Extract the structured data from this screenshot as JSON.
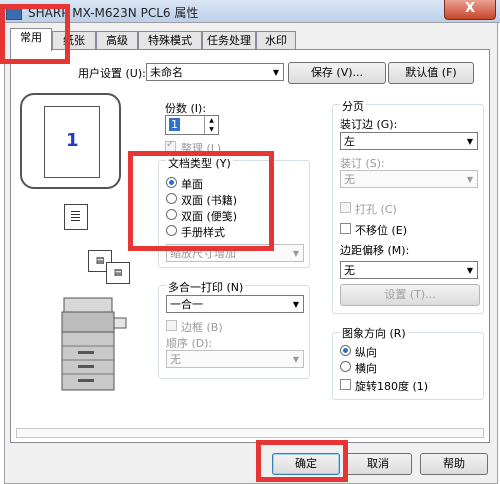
{
  "window": {
    "title": "SHARP MX-M623N PCL6 属性",
    "close_symbol": "X"
  },
  "tabs": [
    "常用",
    "纸张",
    "高级",
    "特殊模式",
    "任务处理",
    "水印"
  ],
  "user_settings": {
    "label": "用户设置 (U):",
    "value": "未命名",
    "save": "保存 (V)...",
    "default": "默认值 (F)"
  },
  "preview": {
    "page_number": "1"
  },
  "copies": {
    "label": "份数 (I):",
    "value": "1"
  },
  "collate": {
    "label": "整理 (L)"
  },
  "doc_type": {
    "title": "文档类型 (Y)",
    "options": [
      "单面",
      "双面 (书籍)",
      "双面 (便笺)",
      "手册样式"
    ],
    "selected": "单面",
    "sub_select": "缩放尺寸增加"
  },
  "nup": {
    "label": "多合一打印 (N)",
    "value": "一合一",
    "border": "边框 (B)",
    "order_label": "顺序 (D):",
    "order_value": "无"
  },
  "finishing": {
    "title": "分页",
    "binding_label": "装订边 (G):",
    "binding_value": "左",
    "staple_label": "装订 (S):",
    "staple_value": "无",
    "punch": "打孔 (C)",
    "no_offset": "不移位 (E)",
    "margin_label": "边距偏移 (M):",
    "margin_value": "无",
    "settings": "设置 (T)..."
  },
  "orientation": {
    "title": "图象方向 (R)",
    "portrait": "纵向",
    "landscape": "横向",
    "rotate": "旋转180度 (1)"
  },
  "buttons": {
    "ok": "确定",
    "cancel": "取消",
    "help": "帮助"
  }
}
